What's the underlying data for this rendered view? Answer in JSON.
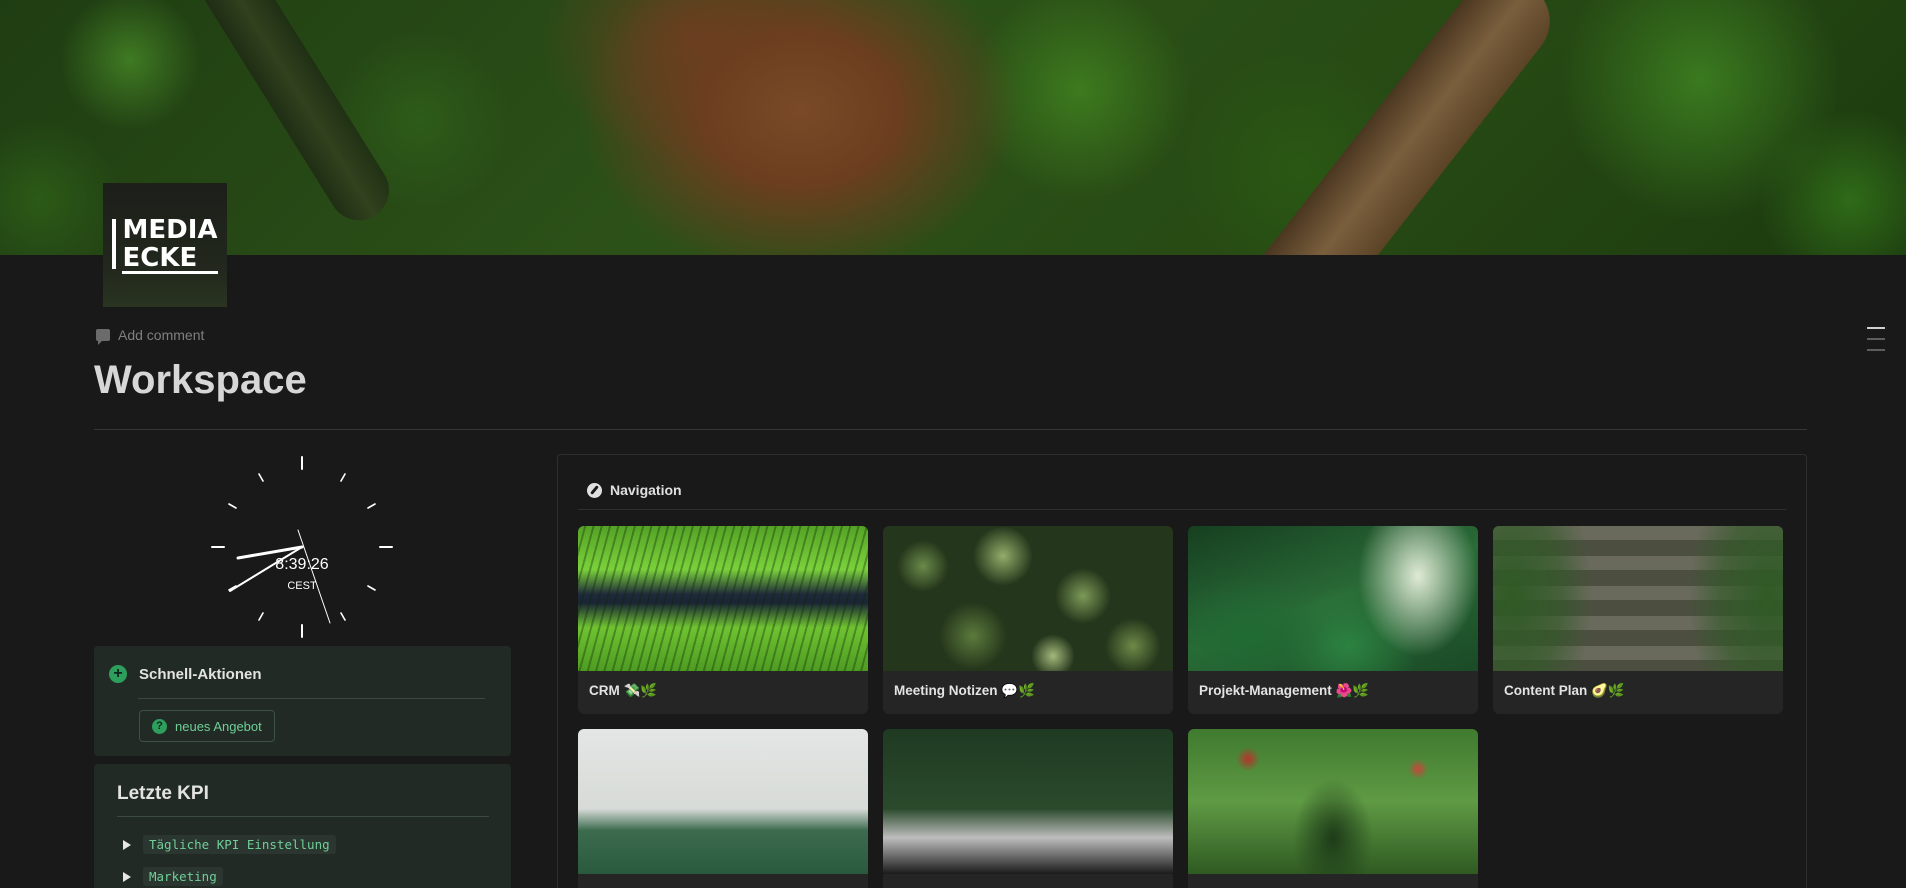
{
  "page": {
    "title": "Workspace",
    "add_comment": "Add comment"
  },
  "logo": {
    "line1": "MEDIA",
    "line2": "ECKE"
  },
  "clock": {
    "time": "8:39:26",
    "timezone": "CEST"
  },
  "quick_actions": {
    "title": "Schnell-Aktionen",
    "button_label": "neues Angebot"
  },
  "kpi": {
    "title": "Letzte KPI",
    "items": [
      {
        "label": "Tägliche KPI Einstellung"
      },
      {
        "label": "Marketing"
      }
    ]
  },
  "navigation": {
    "title": "Navigation",
    "cards": [
      {
        "label": "CRM 💸🌿"
      },
      {
        "label": "Meeting Notizen 💬🌿"
      },
      {
        "label": "Projekt-Management 🌺🌿"
      },
      {
        "label": "Content Plan 🥑🌿"
      },
      {
        "label": ""
      },
      {
        "label": ""
      },
      {
        "label": ""
      }
    ]
  },
  "icons": {
    "comment": "comment-icon",
    "plus": "plus-circle-icon",
    "question": "question-circle-icon",
    "compass": "compass-icon",
    "toggle": "triangle-right-icon"
  },
  "colors": {
    "background": "#191919",
    "accent_green": "#6fcf97",
    "callout_bg": "#212a25"
  }
}
